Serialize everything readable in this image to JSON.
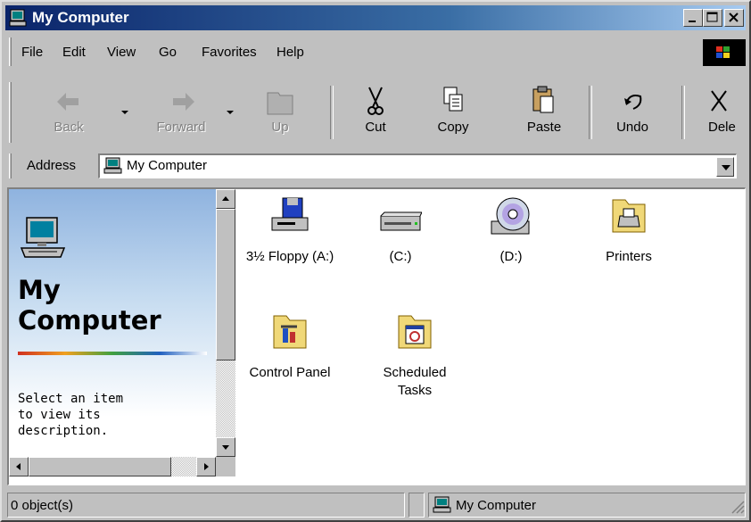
{
  "window": {
    "title": "My Computer"
  },
  "menu": [
    "File",
    "Edit",
    "View",
    "Go",
    "Favorites",
    "Help"
  ],
  "toolbar": {
    "back": "Back",
    "forward": "Forward",
    "up": "Up",
    "cut": "Cut",
    "copy": "Copy",
    "paste": "Paste",
    "undo": "Undo",
    "delete": "Dele"
  },
  "address": {
    "label": "Address",
    "value": "My Computer"
  },
  "left_pane": {
    "title_line1": "My",
    "title_line2": "Computer",
    "desc_line1": "Select an item",
    "desc_line2": "to view its",
    "desc_line3": "description."
  },
  "items": [
    {
      "label": "3½ Floppy (A:)",
      "icon": "floppy-drive-icon"
    },
    {
      "label": "(C:)",
      "icon": "hard-drive-icon"
    },
    {
      "label": "(D:)",
      "icon": "cd-drive-icon"
    },
    {
      "label": "Printers",
      "icon": "printers-folder-icon"
    },
    {
      "label": "Control Panel",
      "icon": "control-panel-folder-icon"
    },
    {
      "label": "Scheduled Tasks",
      "icon": "scheduled-tasks-folder-icon"
    }
  ],
  "status": {
    "objects": "0 object(s)",
    "location": "My Computer"
  }
}
